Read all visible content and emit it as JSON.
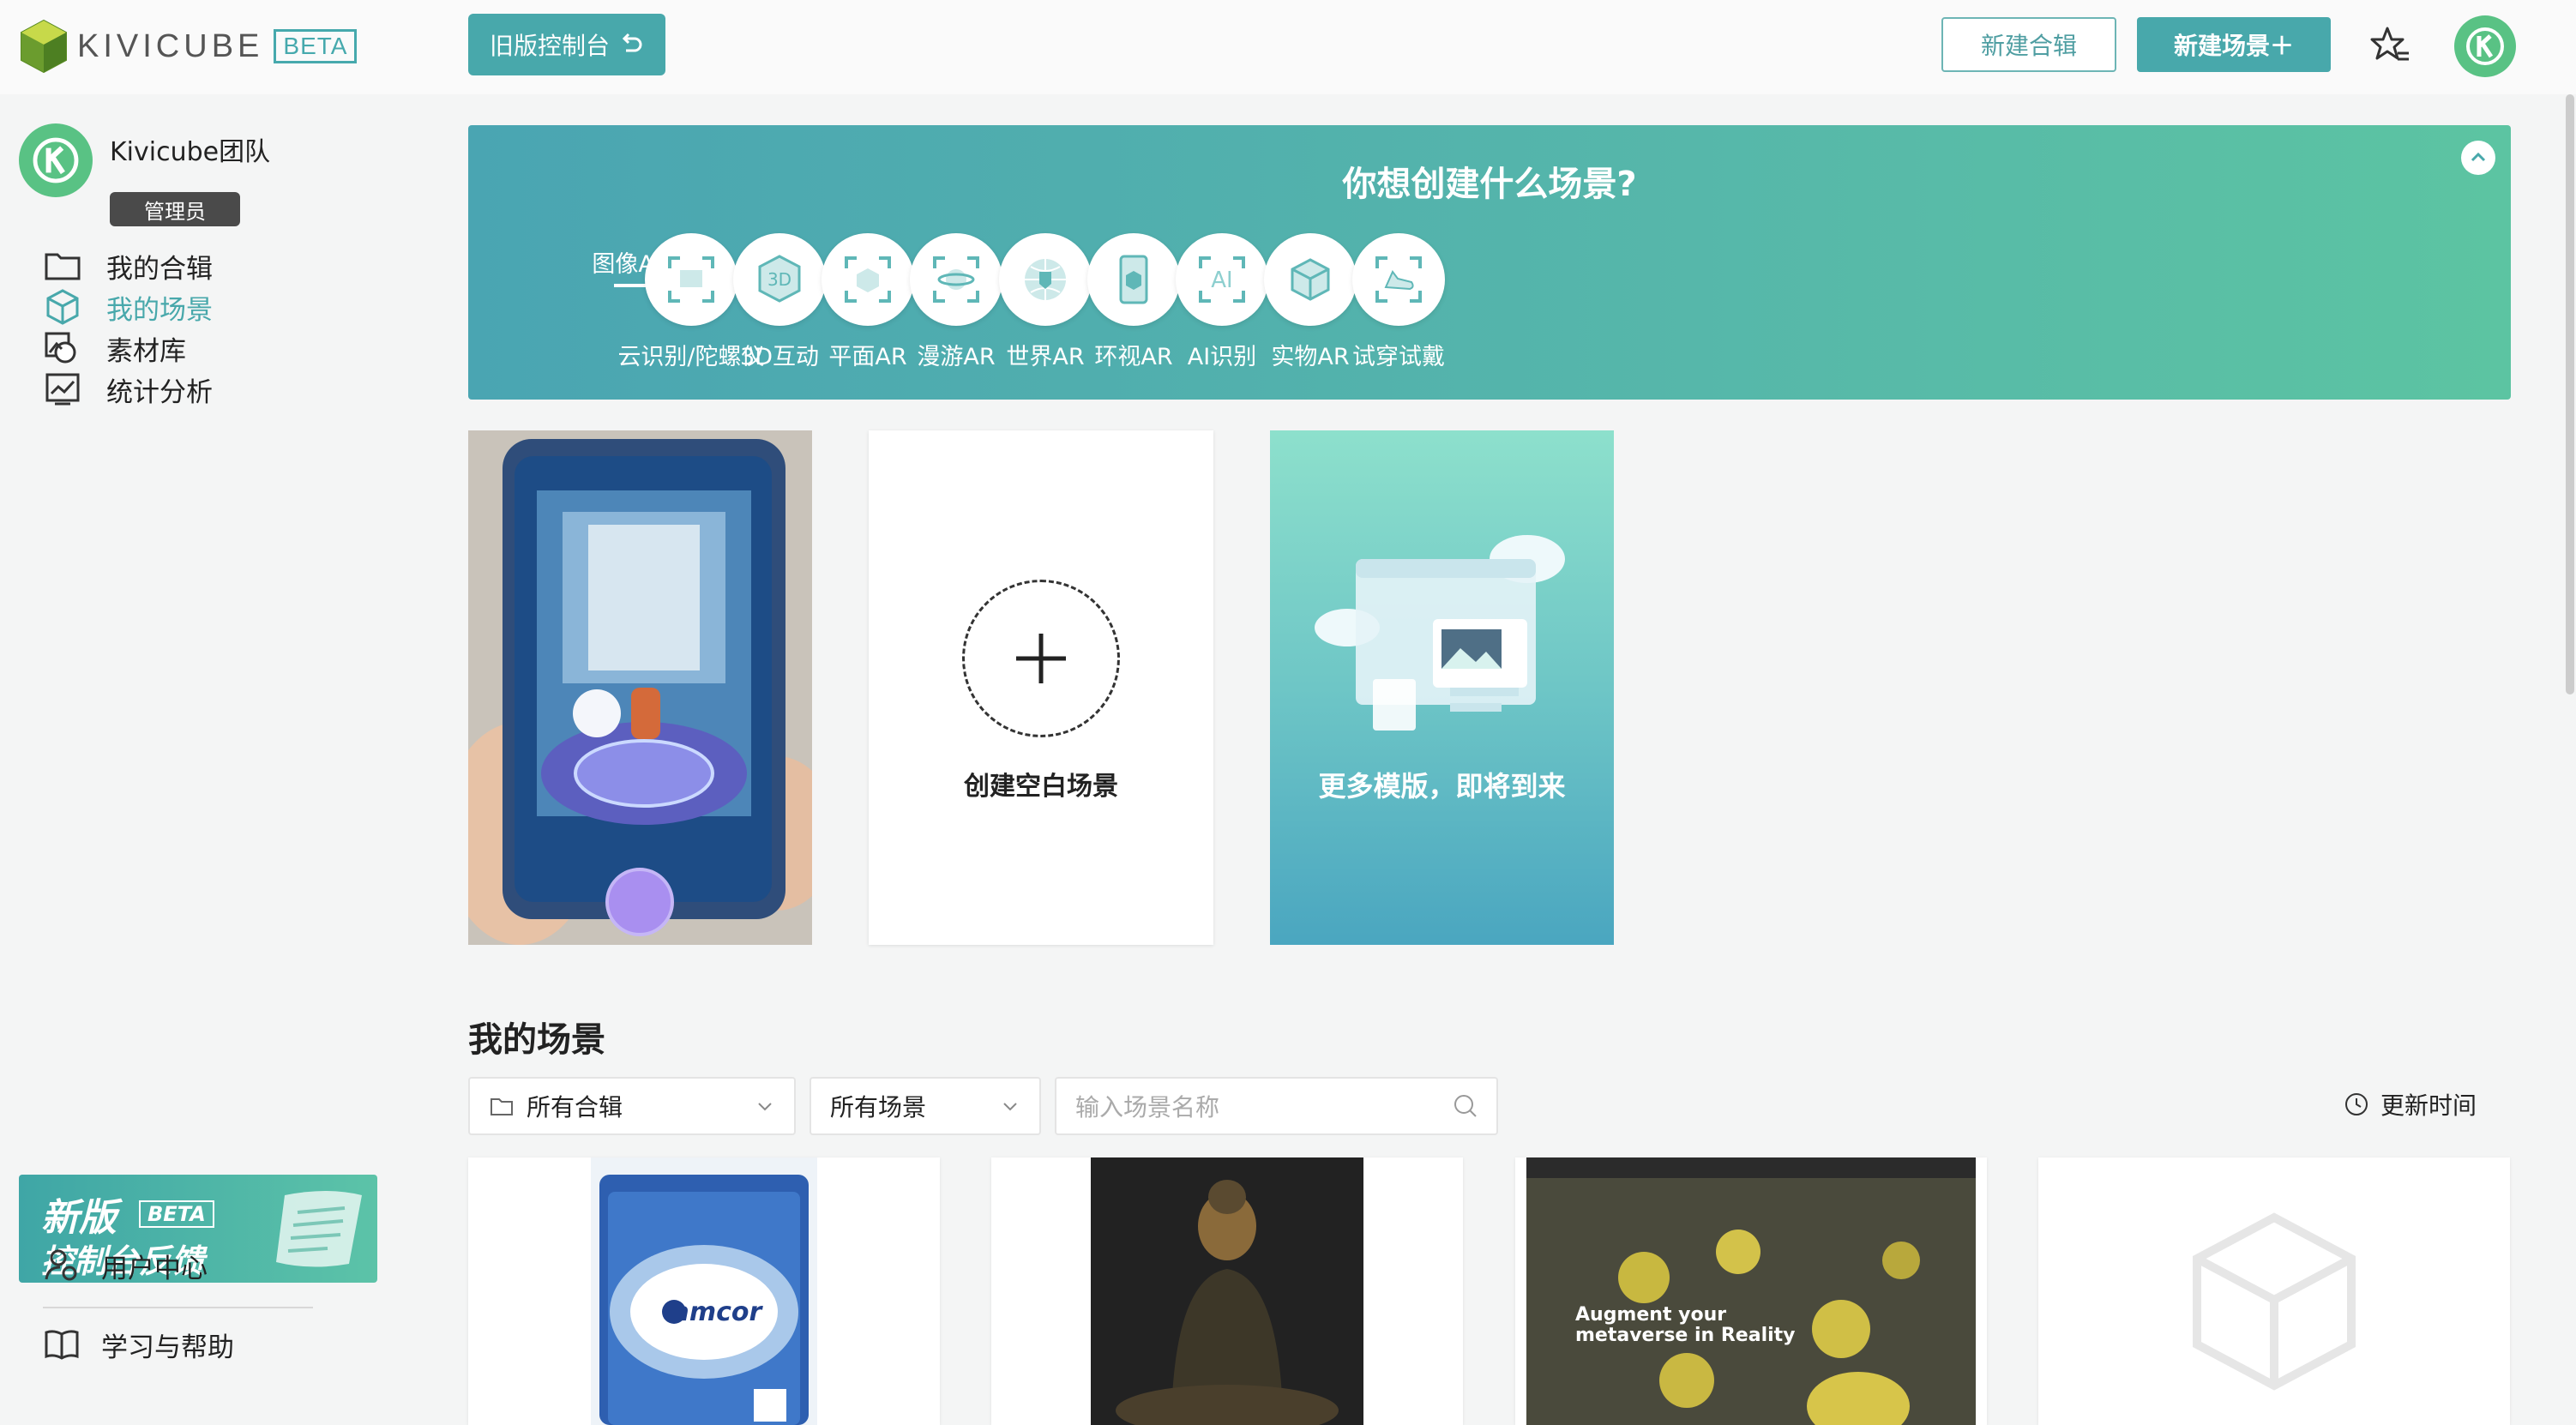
{
  "header": {
    "logo_text": "KIVICUBE",
    "beta_label": "BETA",
    "old_console_label": "旧版控制台",
    "new_collection_label": "新建合辑",
    "new_scene_label": "新建场景＋",
    "star_icon": "star-list-icon",
    "avatar_icon": "kivicube-avatar"
  },
  "sidebar": {
    "team_name": "Kivicube团队",
    "role": "管理员",
    "items": [
      {
        "label": "我的合辑",
        "icon": "folder-icon",
        "active": false
      },
      {
        "label": "我的场景",
        "icon": "cube-icon",
        "active": true
      },
      {
        "label": "素材库",
        "icon": "assets-icon",
        "active": false
      },
      {
        "label": "统计分析",
        "icon": "analytics-icon",
        "active": false
      }
    ],
    "feedback": {
      "line1": "新版",
      "beta": "BETA",
      "line2": "控制台反馈"
    },
    "bottom_items": [
      {
        "label": "用户中心",
        "icon": "user-center-icon"
      },
      {
        "label": "学习与帮助",
        "icon": "book-icon"
      }
    ]
  },
  "banner": {
    "title": "你想创建什么场景?",
    "categories": [
      {
        "label": "图像AR",
        "icon": "image-ar-icon",
        "selected": true
      },
      {
        "label": "云识别/陀螺仪",
        "icon": "cloud-recognition-icon",
        "selected": false
      },
      {
        "label": "3D互动",
        "icon": "3d-interaction-icon",
        "icon_text": "3D",
        "selected": false
      },
      {
        "label": "平面AR",
        "icon": "plane-ar-icon",
        "selected": false
      },
      {
        "label": "漫游AR",
        "icon": "roaming-ar-icon",
        "selected": false
      },
      {
        "label": "世界AR",
        "icon": "world-ar-icon",
        "selected": false
      },
      {
        "label": "环视AR",
        "icon": "panorama-ar-icon",
        "selected": false
      },
      {
        "label": "AI识别",
        "icon": "ai-recognition-icon",
        "icon_text": "AI",
        "selected": false
      },
      {
        "label": "实物AR",
        "icon": "object-ar-icon",
        "selected": false
      },
      {
        "label": "试穿试戴",
        "icon": "try-on-icon",
        "selected": false
      }
    ]
  },
  "templates": {
    "create_blank_label": "创建空白场景",
    "more_label": "更多模版，即将到来"
  },
  "scenes_section": {
    "title": "我的场景",
    "collection_filter": "所有合辑",
    "scene_filter": "所有场景",
    "search_placeholder": "输入场景名称",
    "sort_label": "更新时间",
    "cards": [
      {
        "thumbnail": "amcor-package",
        "brand_text": "amcor"
      },
      {
        "thumbnail": "buddha-statue"
      },
      {
        "thumbnail": "metaverse-webpage",
        "headline": "Augment your metaverse in Reality"
      },
      {
        "thumbnail": "placeholder-cube"
      }
    ]
  }
}
